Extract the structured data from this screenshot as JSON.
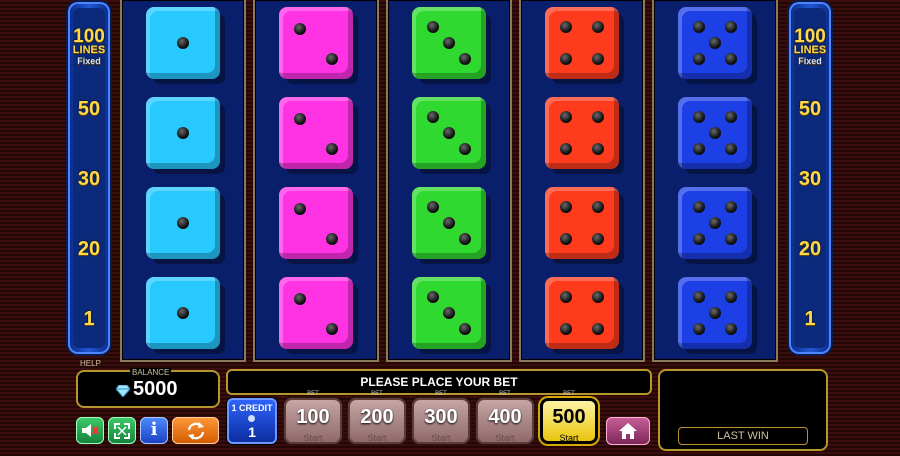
{
  "side_labels": {
    "top_value": "100",
    "lines_word": "LINES",
    "fixed_word": "Fixed",
    "levels": [
      "50",
      "30",
      "20",
      "1"
    ]
  },
  "help_label": "HELP",
  "balance": {
    "label": "BALANCE",
    "value": "5000"
  },
  "message": "PLEASE PLACE YOUR BET",
  "last_win": {
    "label": "LAST WIN",
    "value": ""
  },
  "credit": {
    "label": "1 CREDIT",
    "value": "1"
  },
  "bets": [
    {
      "tag": "BET",
      "value": "100",
      "start": "Start",
      "selected": false
    },
    {
      "tag": "BET",
      "value": "200",
      "start": "Start",
      "selected": false
    },
    {
      "tag": "BET",
      "value": "300",
      "start": "Start",
      "selected": false
    },
    {
      "tag": "BET",
      "value": "400",
      "start": "Start",
      "selected": false
    },
    {
      "tag": "BET",
      "value": "500",
      "start": "Start",
      "selected": true
    }
  ],
  "icons": [
    "sound-off-icon",
    "fullscreen-icon",
    "info-icon",
    "autoplay-icon",
    "home-icon",
    "diamond-icon"
  ],
  "reels": [
    {
      "color": "#27c9ff",
      "faces": [
        1,
        1,
        1,
        1
      ]
    },
    {
      "color": "#ff33e4",
      "faces": [
        2,
        2,
        2,
        2
      ]
    },
    {
      "color": "#2fd92f",
      "faces": [
        3,
        3,
        3,
        3
      ]
    },
    {
      "color": "#ff3b1e",
      "faces": [
        4,
        4,
        4,
        4
      ]
    },
    {
      "color": "#1d3fe6",
      "faces": [
        5,
        5,
        5,
        5
      ]
    }
  ]
}
